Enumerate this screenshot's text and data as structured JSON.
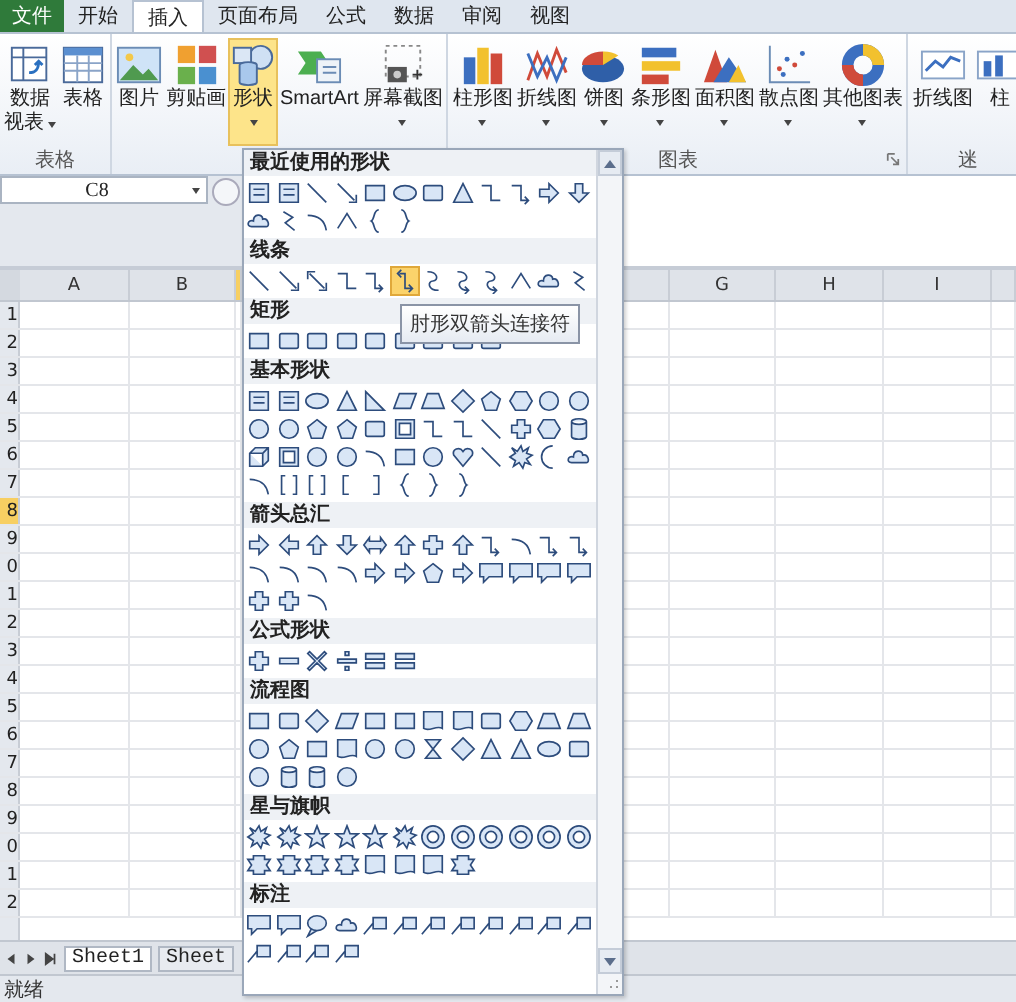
{
  "tabs": [
    {
      "label": "文件",
      "kind": "file",
      "selected": false
    },
    {
      "label": "开始",
      "kind": "tab",
      "selected": false
    },
    {
      "label": "插入",
      "kind": "tab",
      "selected": true
    },
    {
      "label": "页面布局",
      "kind": "tab",
      "selected": false
    },
    {
      "label": "公式",
      "kind": "tab",
      "selected": false
    },
    {
      "label": "数据",
      "kind": "tab",
      "selected": false
    },
    {
      "label": "审阅",
      "kind": "tab",
      "selected": false
    },
    {
      "label": "视图",
      "kind": "tab",
      "selected": false
    }
  ],
  "ribbon": {
    "groups": [
      {
        "label": "表格",
        "buttons": [
          {
            "lines": [
              "数据",
              "视表"
            ],
            "dropdown": true,
            "selected": false
          },
          {
            "lines": [
              "表格"
            ],
            "dropdown": false,
            "selected": false
          }
        ]
      },
      {
        "buttons": [
          {
            "lines": [
              "图片"
            ],
            "dropdown": false,
            "selected": false
          },
          {
            "lines": [
              "剪贴画"
            ],
            "dropdown": false,
            "selected": false
          },
          {
            "lines": [
              "形状"
            ],
            "dropdown": true,
            "selected": true
          },
          {
            "lines": [
              "SmartArt"
            ],
            "dropdown": false,
            "selected": false
          },
          {
            "lines": [
              "屏幕截图"
            ],
            "dropdown": true,
            "selected": false
          }
        ]
      },
      {
        "label": "图表",
        "launcher": true,
        "buttons": [
          {
            "lines": [
              "柱形图"
            ],
            "dropdown": true,
            "selected": false
          },
          {
            "lines": [
              "折线图"
            ],
            "dropdown": true,
            "selected": false
          },
          {
            "lines": [
              "饼图"
            ],
            "dropdown": true,
            "selected": false
          },
          {
            "lines": [
              "条形图"
            ],
            "dropdown": true,
            "selected": false
          },
          {
            "lines": [
              "面积图"
            ],
            "dropdown": true,
            "selected": false
          },
          {
            "lines": [
              "散点图"
            ],
            "dropdown": true,
            "selected": false
          },
          {
            "lines": [
              "其他图表"
            ],
            "dropdown": true,
            "selected": false
          }
        ]
      },
      {
        "label": "迷",
        "buttons": [
          {
            "lines": [
              "折线图"
            ],
            "dropdown": false,
            "selected": false
          },
          {
            "lines": [
              "柱"
            ],
            "dropdown": false,
            "selected": false
          }
        ]
      }
    ]
  },
  "name_box": "C8",
  "columns": [
    {
      "label": "A",
      "selected": false
    },
    {
      "label": "B",
      "selected": false
    },
    {
      "selected": true
    },
    {
      "selected": false
    },
    {
      "label": "G",
      "selected": false
    },
    {
      "label": "H",
      "selected": false
    },
    {
      "label": "I",
      "selected": false
    },
    {
      "selected": false
    }
  ],
  "rows": [
    {
      "label": "1",
      "selected": false
    },
    {
      "label": "2",
      "selected": false
    },
    {
      "label": "3",
      "selected": false
    },
    {
      "label": "4",
      "selected": false
    },
    {
      "label": "5",
      "selected": false
    },
    {
      "label": "6",
      "selected": false
    },
    {
      "label": "7",
      "selected": false
    },
    {
      "label": "8",
      "selected": true
    },
    {
      "label": "9",
      "selected": false
    },
    {
      "label": "0",
      "selected": false
    },
    {
      "label": "1",
      "selected": false
    },
    {
      "label": "2",
      "selected": false
    },
    {
      "label": "3",
      "selected": false
    },
    {
      "label": "4",
      "selected": false
    },
    {
      "label": "5",
      "selected": false
    },
    {
      "label": "6",
      "selected": false
    },
    {
      "label": "7",
      "selected": false
    },
    {
      "label": "8",
      "selected": false
    },
    {
      "label": "9",
      "selected": false
    },
    {
      "label": "0",
      "selected": false
    },
    {
      "label": "1",
      "selected": false
    },
    {
      "label": "2",
      "selected": false
    }
  ],
  "sheet_tabs": [
    {
      "label": "Sheet1",
      "selected": true
    },
    {
      "label": "Sheet",
      "selected": false
    }
  ],
  "status_bar": "就绪",
  "shapes_menu": {
    "sections": [
      {
        "title": "最近使用的形状",
        "shapes": [
          {
            "selected": false
          },
          {
            "selected": false
          },
          {
            "selected": false
          },
          {
            "selected": false
          },
          {
            "selected": false
          },
          {
            "selected": false
          },
          {
            "selected": false
          },
          {
            "selected": false
          },
          {
            "selected": false
          },
          {
            "selected": false
          },
          {
            "selected": false
          },
          {
            "selected": false
          },
          {
            "selected": false
          },
          {
            "selected": false
          },
          {
            "selected": false
          },
          {
            "selected": false
          },
          {
            "selected": false
          },
          {
            "selected": false
          }
        ]
      },
      {
        "title": "线条",
        "shapes": [
          {
            "selected": false
          },
          {
            "selected": false
          },
          {
            "selected": false
          },
          {
            "selected": false
          },
          {
            "selected": false
          },
          {
            "selected": true
          },
          {
            "selected": false
          },
          {
            "selected": false
          },
          {
            "selected": false
          },
          {
            "selected": false
          },
          {
            "selected": false
          },
          {
            "selected": false
          }
        ]
      },
      {
        "title": "矩形",
        "shapes": [
          {
            "selected": false
          },
          {
            "selected": false
          },
          {
            "selected": false
          },
          {
            "selected": false
          },
          {
            "selected": false
          },
          {
            "selected": false
          },
          {
            "selected": false
          },
          {
            "selected": false
          },
          {
            "selected": false
          }
        ]
      },
      {
        "title": "基本形状",
        "shapes": [
          {
            "selected": false
          },
          {
            "selected": false
          },
          {
            "selected": false
          },
          {
            "selected": false
          },
          {
            "selected": false
          },
          {
            "selected": false
          },
          {
            "selected": false
          },
          {
            "selected": false
          },
          {
            "selected": false
          },
          {
            "selected": false
          },
          {
            "selected": false
          },
          {
            "selected": false
          },
          {
            "selected": false
          },
          {
            "selected": false
          },
          {
            "selected": false
          },
          {
            "selected": false
          },
          {
            "selected": false
          },
          {
            "selected": false
          },
          {
            "selected": false
          },
          {
            "selected": false
          },
          {
            "selected": false
          },
          {
            "selected": false
          },
          {
            "selected": false
          },
          {
            "selected": false
          },
          {
            "selected": false
          },
          {
            "selected": false
          },
          {
            "selected": false
          },
          {
            "selected": false
          },
          {
            "selected": false
          },
          {
            "selected": false
          },
          {
            "selected": false
          },
          {
            "selected": false
          },
          {
            "selected": false
          },
          {
            "selected": false
          },
          {
            "selected": false
          },
          {
            "selected": false
          },
          {
            "selected": false
          },
          {
            "selected": false
          },
          {
            "selected": false
          },
          {
            "selected": false
          },
          {
            "selected": false
          },
          {
            "selected": false
          },
          {
            "selected": false
          },
          {
            "selected": false
          }
        ]
      },
      {
        "title": "箭头总汇",
        "shapes": [
          {
            "selected": false
          },
          {
            "selected": false
          },
          {
            "selected": false
          },
          {
            "selected": false
          },
          {
            "selected": false
          },
          {
            "selected": false
          },
          {
            "selected": false
          },
          {
            "selected": false
          },
          {
            "selected": false
          },
          {
            "selected": false
          },
          {
            "selected": false
          },
          {
            "selected": false
          },
          {
            "selected": false
          },
          {
            "selected": false
          },
          {
            "selected": false
          },
          {
            "selected": false
          },
          {
            "selected": false
          },
          {
            "selected": false
          },
          {
            "selected": false
          },
          {
            "selected": false
          },
          {
            "selected": false
          },
          {
            "selected": false
          },
          {
            "selected": false
          },
          {
            "selected": false
          },
          {
            "selected": false
          },
          {
            "selected": false
          },
          {
            "selected": false
          }
        ]
      },
      {
        "title": "公式形状",
        "shapes": [
          {
            "selected": false
          },
          {
            "selected": false
          },
          {
            "selected": false
          },
          {
            "selected": false
          },
          {
            "selected": false
          },
          {
            "selected": false
          }
        ]
      },
      {
        "title": "流程图",
        "shapes": [
          {
            "selected": false
          },
          {
            "selected": false
          },
          {
            "selected": false
          },
          {
            "selected": false
          },
          {
            "selected": false
          },
          {
            "selected": false
          },
          {
            "selected": false
          },
          {
            "selected": false
          },
          {
            "selected": false
          },
          {
            "selected": false
          },
          {
            "selected": false
          },
          {
            "selected": false
          },
          {
            "selected": false
          },
          {
            "selected": false
          },
          {
            "selected": false
          },
          {
            "selected": false
          },
          {
            "selected": false
          },
          {
            "selected": false
          },
          {
            "selected": false
          },
          {
            "selected": false
          },
          {
            "selected": false
          },
          {
            "selected": false
          },
          {
            "selected": false
          },
          {
            "selected": false
          },
          {
            "selected": false
          },
          {
            "selected": false
          },
          {
            "selected": false
          },
          {
            "selected": false
          }
        ]
      },
      {
        "title": "星与旗帜",
        "shapes": [
          {
            "selected": false
          },
          {
            "selected": false
          },
          {
            "selected": false
          },
          {
            "selected": false
          },
          {
            "selected": false
          },
          {
            "selected": false
          },
          {
            "selected": false
          },
          {
            "selected": false
          },
          {
            "selected": false
          },
          {
            "selected": false
          },
          {
            "selected": false
          },
          {
            "selected": false
          },
          {
            "selected": false
          },
          {
            "selected": false
          },
          {
            "selected": false
          },
          {
            "selected": false
          },
          {
            "selected": false
          },
          {
            "selected": false
          },
          {
            "selected": false
          },
          {
            "selected": false
          }
        ]
      },
      {
        "title": "标注",
        "shapes": [
          {
            "selected": false
          },
          {
            "selected": false
          },
          {
            "selected": false
          },
          {
            "selected": false
          },
          {
            "selected": false
          },
          {
            "selected": false
          },
          {
            "selected": false
          },
          {
            "selected": false
          },
          {
            "selected": false
          },
          {
            "selected": false
          },
          {
            "selected": false
          },
          {
            "selected": false
          },
          {
            "selected": false
          },
          {
            "selected": false
          },
          {
            "selected": false
          },
          {
            "selected": false
          }
        ]
      }
    ],
    "tooltip": "肘形双箭头连接符"
  }
}
